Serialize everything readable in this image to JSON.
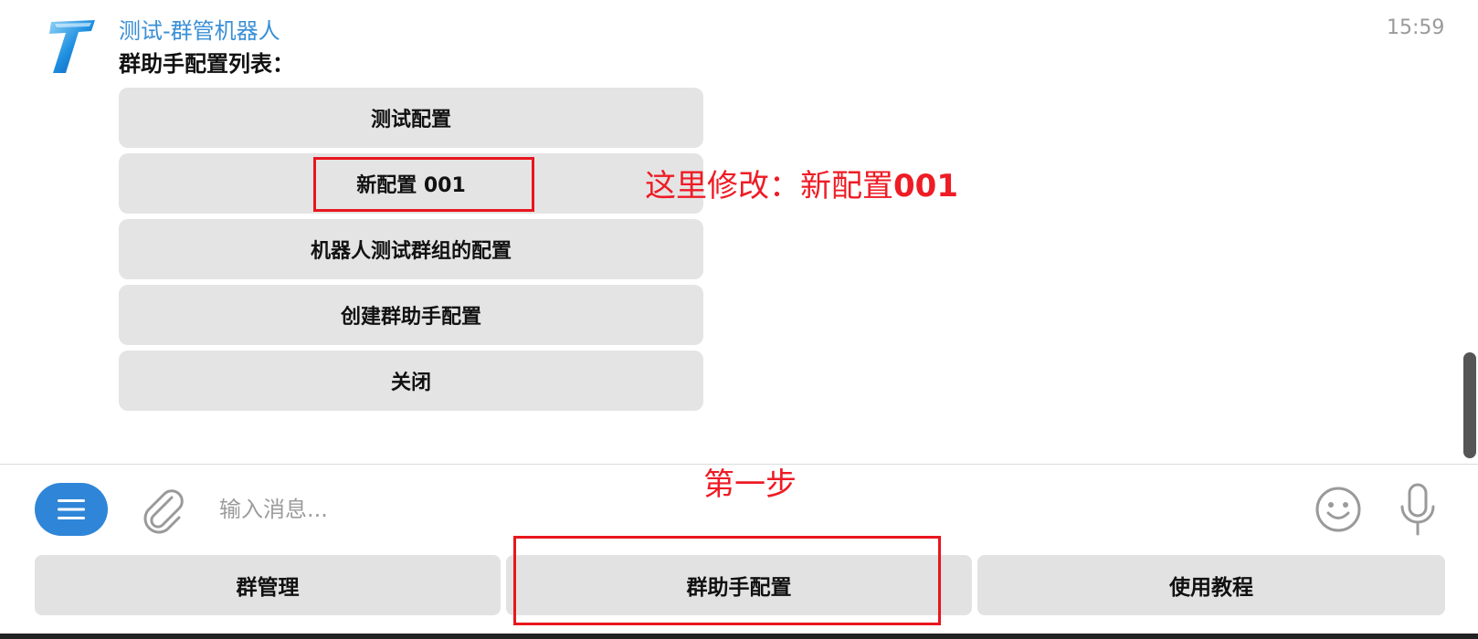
{
  "chat": {
    "bot_name": "测试-群管机器人",
    "timestamp": "15:59",
    "message_text": "群助手配置列表：",
    "inline_buttons": [
      "测试配置",
      "新配置 001",
      "机器人测试群组的配置",
      "创建群助手配置",
      "关闭"
    ]
  },
  "annotations": {
    "modify_prefix": "这里修改：新配置",
    "modify_suffix": "001",
    "step_one": "第一步"
  },
  "composer": {
    "placeholder": "输入消息...",
    "icons": [
      "menu-icon",
      "paperclip-icon",
      "emoji-icon",
      "microphone-icon"
    ]
  },
  "reply_keyboard": [
    "群管理",
    "群助手配置",
    "使用教程"
  ],
  "colors": {
    "accent": "#2f86d8",
    "bot_name": "#3a8fd6",
    "annotation": "#e8161e",
    "button_bg": "#e4e4e4"
  }
}
